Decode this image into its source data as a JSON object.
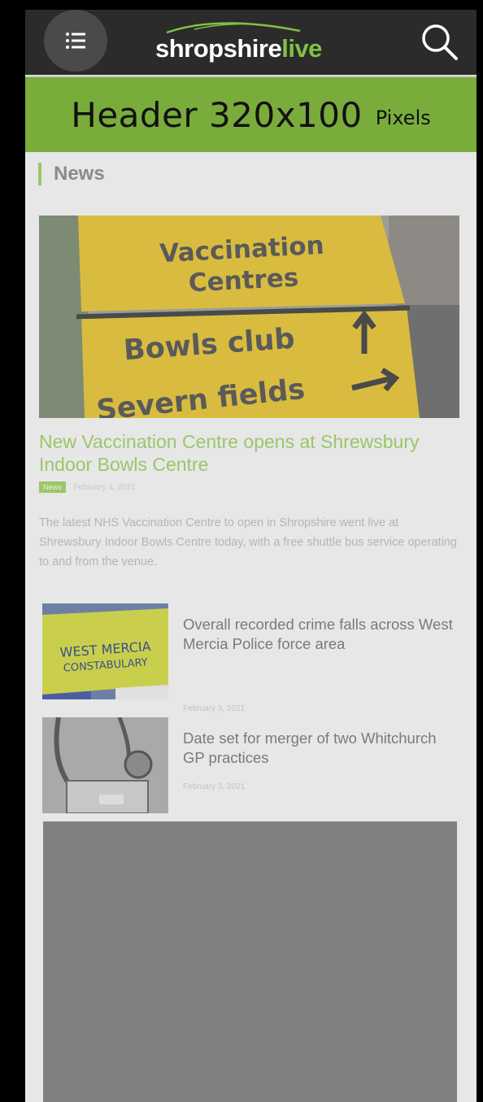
{
  "header": {
    "logo": {
      "part1": "shropshire",
      "part2": "live",
      "brand_color": "#7fc241"
    },
    "menu_icon": "list-menu-icon",
    "search_icon": "search-icon"
  },
  "ad_banner": {
    "main_text": "Header 320x100",
    "small_text": "Pixels",
    "background": "#7aac3b"
  },
  "section": {
    "title": "News"
  },
  "featured": {
    "image_alt": "Road sign: Vaccination Centres, Bowls club, Severn fields",
    "sign_line1": "Vaccination",
    "sign_line2": "Centres",
    "sign_line3": "Bowls club",
    "sign_line4": "Severn fields",
    "title": "New Vaccination Centre opens at Shrewsbury Indoor Bowls Centre",
    "category": "News",
    "date": "February 4, 2021",
    "excerpt": "The latest NHS Vaccination Centre to open in Shropshire went live at Shrewsbury Indoor Bowls Centre today, with a free shuttle bus service operating to and from the venue."
  },
  "list": [
    {
      "title": "Overall recorded crime falls across West Mercia Police force area",
      "date": "February 3, 2021",
      "thumb_text1": "WEST MERCIA",
      "thumb_text2": "CONSTABULARY"
    },
    {
      "title": "Date set for merger of two Whitchurch GP practices",
      "date": "February 3, 2021"
    }
  ],
  "colors": {
    "accent_green": "#9bc66a",
    "topbar": "#2b2b2b",
    "ad_placeholder": "#808080"
  }
}
